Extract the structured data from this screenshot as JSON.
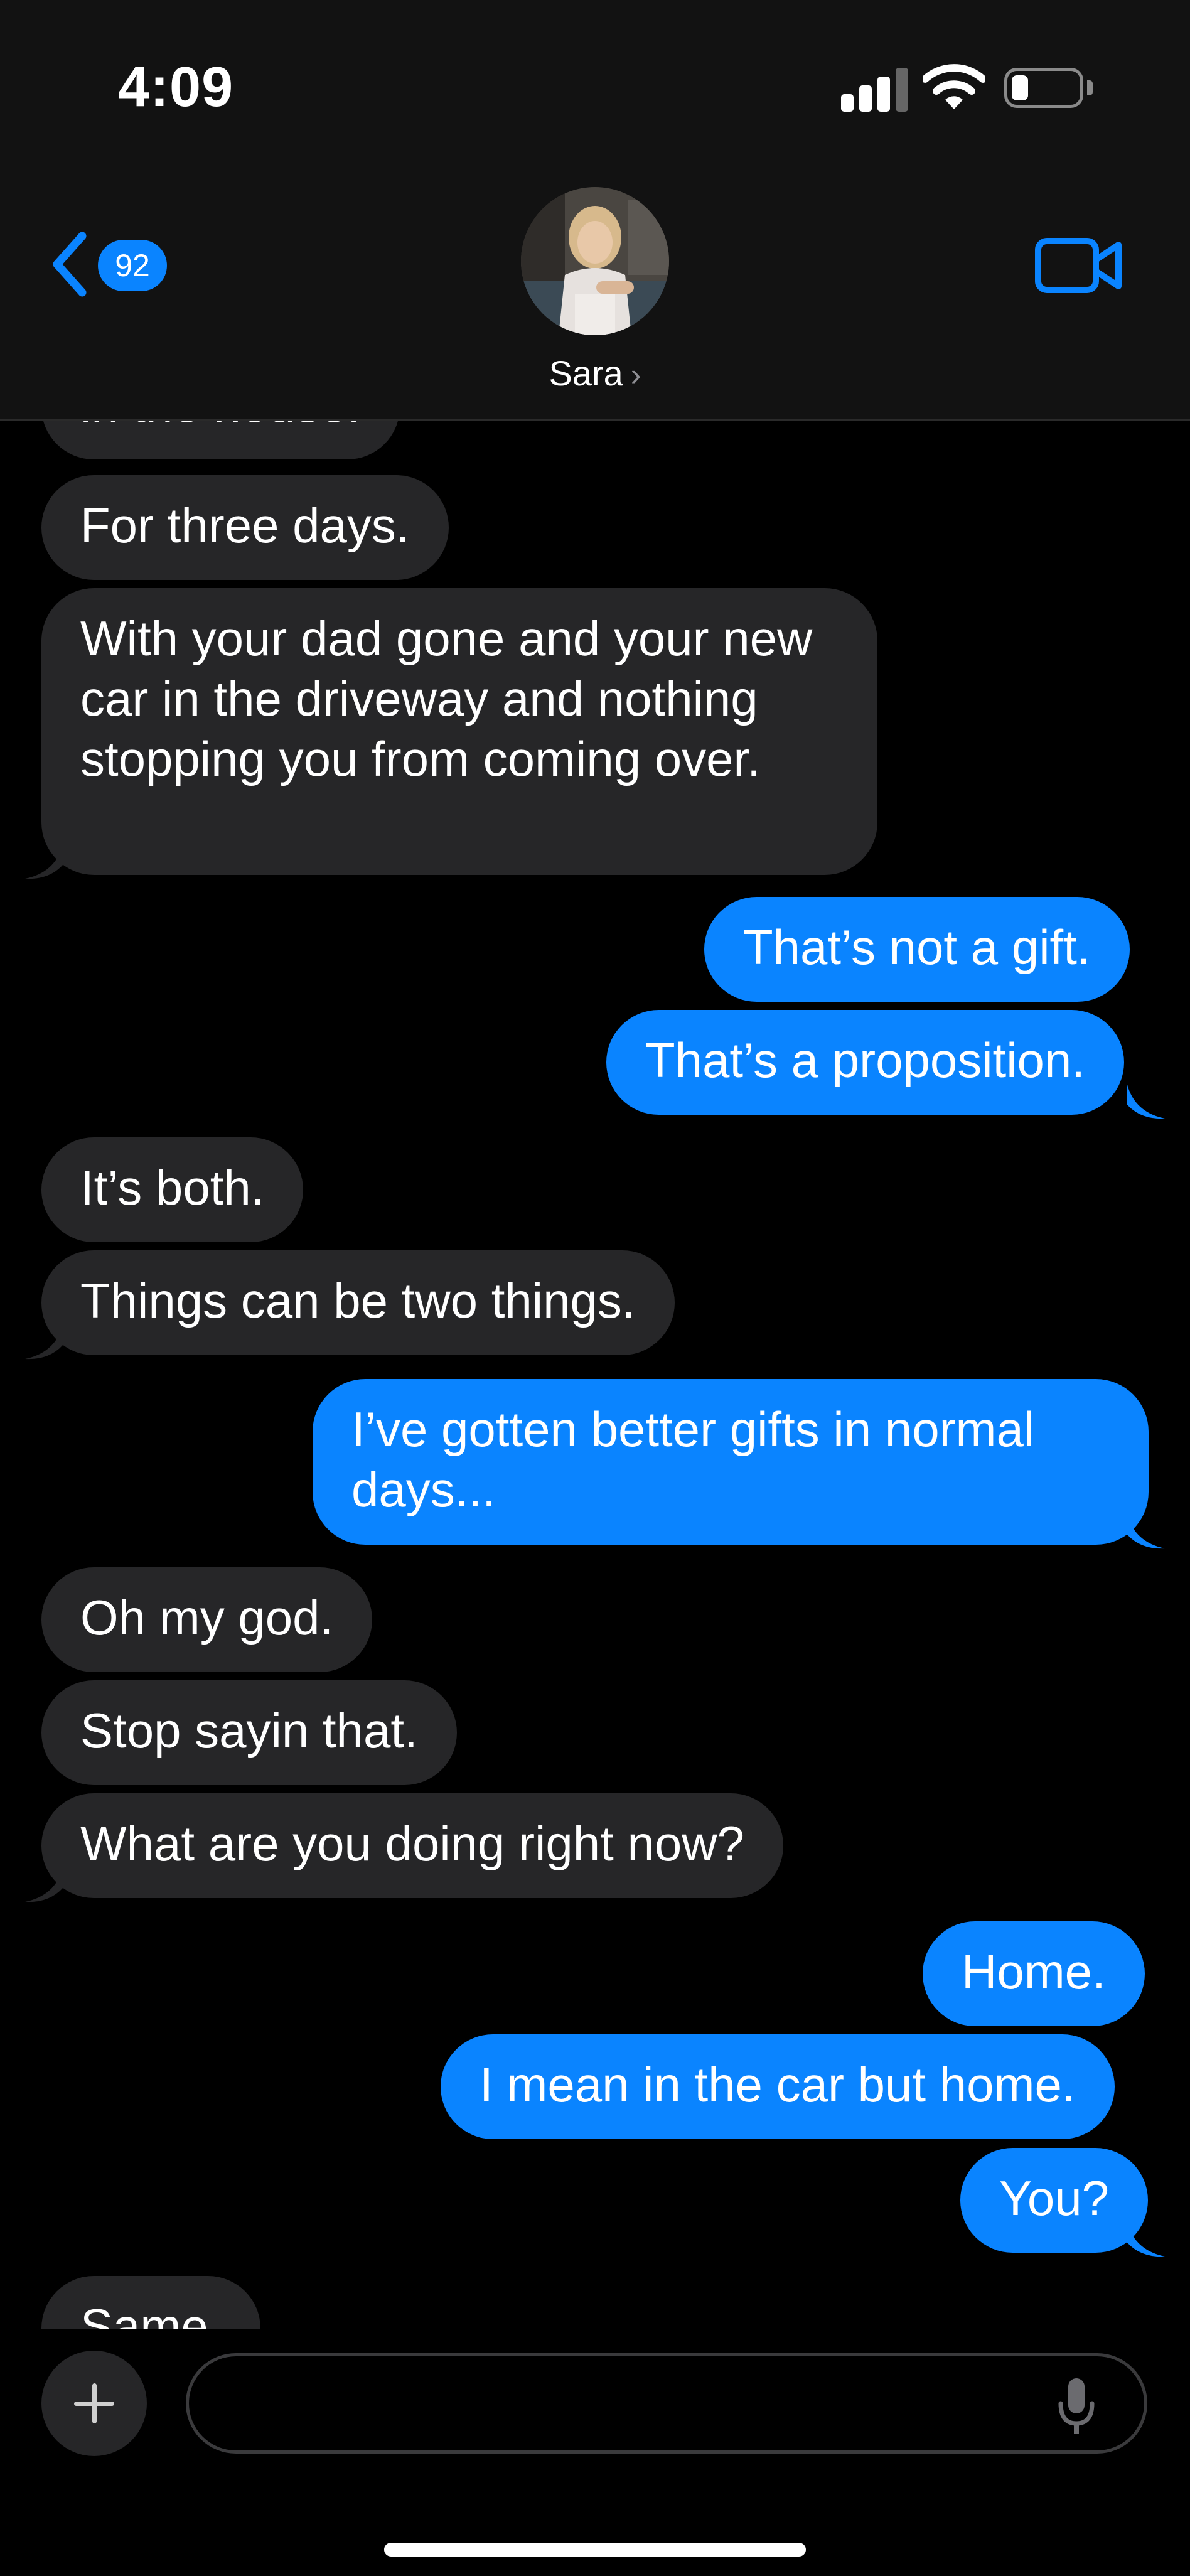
{
  "status_bar": {
    "time": "4:09",
    "icons": [
      "cellular-signal-icon",
      "wifi-icon",
      "battery-icon"
    ]
  },
  "header": {
    "back_badge": "92",
    "contact_name": "Sara",
    "icons": [
      "back-chevron-icon",
      "video-call-icon",
      "contact-avatar"
    ]
  },
  "messages": [
    {
      "dir": "in",
      "text": "in the house."
    },
    {
      "dir": "in",
      "text": "For three days."
    },
    {
      "dir": "in",
      "text": "With your dad gone and your new car in the driveway and nothing stopping you from coming over."
    },
    {
      "dir": "out",
      "text": "That’s not a gift."
    },
    {
      "dir": "out",
      "text": "That’s a proposition."
    },
    {
      "dir": "in",
      "text": "It’s both."
    },
    {
      "dir": "in",
      "text": "Things can be two things."
    },
    {
      "dir": "out",
      "text": "I’ve gotten better gifts in normal days..."
    },
    {
      "dir": "in",
      "text": "Oh my god."
    },
    {
      "dir": "in",
      "text": "Stop sayin that."
    },
    {
      "dir": "in",
      "text": "What are you doing right now?"
    },
    {
      "dir": "out",
      "text": "Home."
    },
    {
      "dir": "out",
      "text": "I mean in the car but home."
    },
    {
      "dir": "out",
      "text": "You?"
    },
    {
      "dir": "in",
      "text": "Same."
    }
  ],
  "composer": {
    "placeholder": "",
    "icons": [
      "plus-icon",
      "microphone-icon"
    ]
  },
  "colors": {
    "accent": "#0a84ff",
    "incoming_bubble": "#262628",
    "background": "#000000",
    "header": "#121212"
  }
}
